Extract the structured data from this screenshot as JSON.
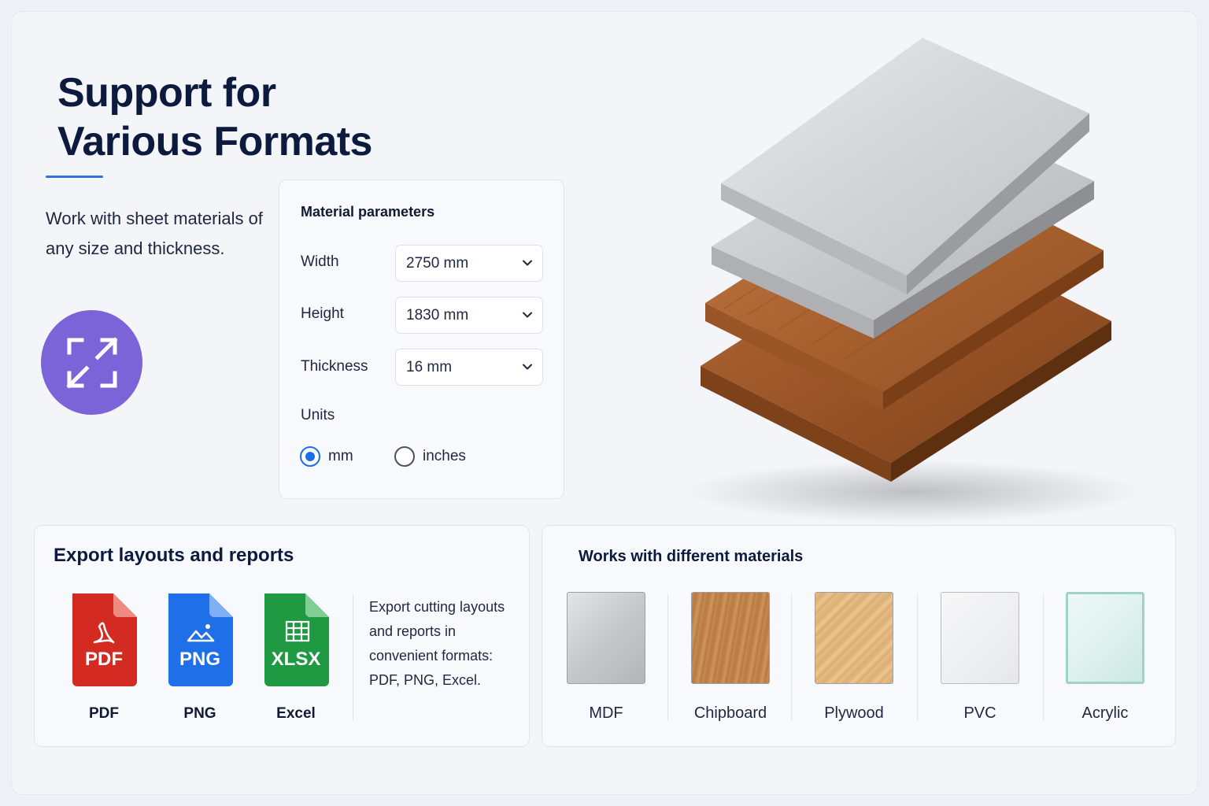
{
  "hero": {
    "title_line1": "Support for",
    "title_line2": "Various Formats",
    "description": "Work with sheet materials of any size and thickness.",
    "accent_color": "#2f73e0",
    "feature_icon": "expand-arrows-icon",
    "feature_icon_color": "#7b63d8"
  },
  "params": {
    "title": "Material parameters",
    "width_label": "Width",
    "width_value": "2750 mm",
    "height_label": "Height",
    "height_value": "1830 mm",
    "thickness_label": "Thickness",
    "thickness_value": "16 mm",
    "units_label": "Units",
    "units_options": [
      "mm",
      "inches"
    ],
    "units_selected": "mm"
  },
  "export": {
    "title": "Export layouts and reports",
    "files": [
      {
        "badge": "PDF",
        "label": "PDF",
        "color": "#d32b22",
        "icon": "acrobat-icon"
      },
      {
        "badge": "PNG",
        "label": "PNG",
        "color": "#1f6fe8",
        "icon": "image-icon"
      },
      {
        "badge": "XLSX",
        "label": "Excel",
        "color": "#1f9a43",
        "icon": "spreadsheet-icon"
      }
    ],
    "description": "Export cutting layouts and reports in convenient formats: PDF, PNG, Excel."
  },
  "materials": {
    "title": "Works with different materials",
    "items": [
      {
        "label": "MDF"
      },
      {
        "label": "Chipboard"
      },
      {
        "label": "Plywood"
      },
      {
        "label": "PVC"
      },
      {
        "label": "Acrylic"
      }
    ]
  }
}
